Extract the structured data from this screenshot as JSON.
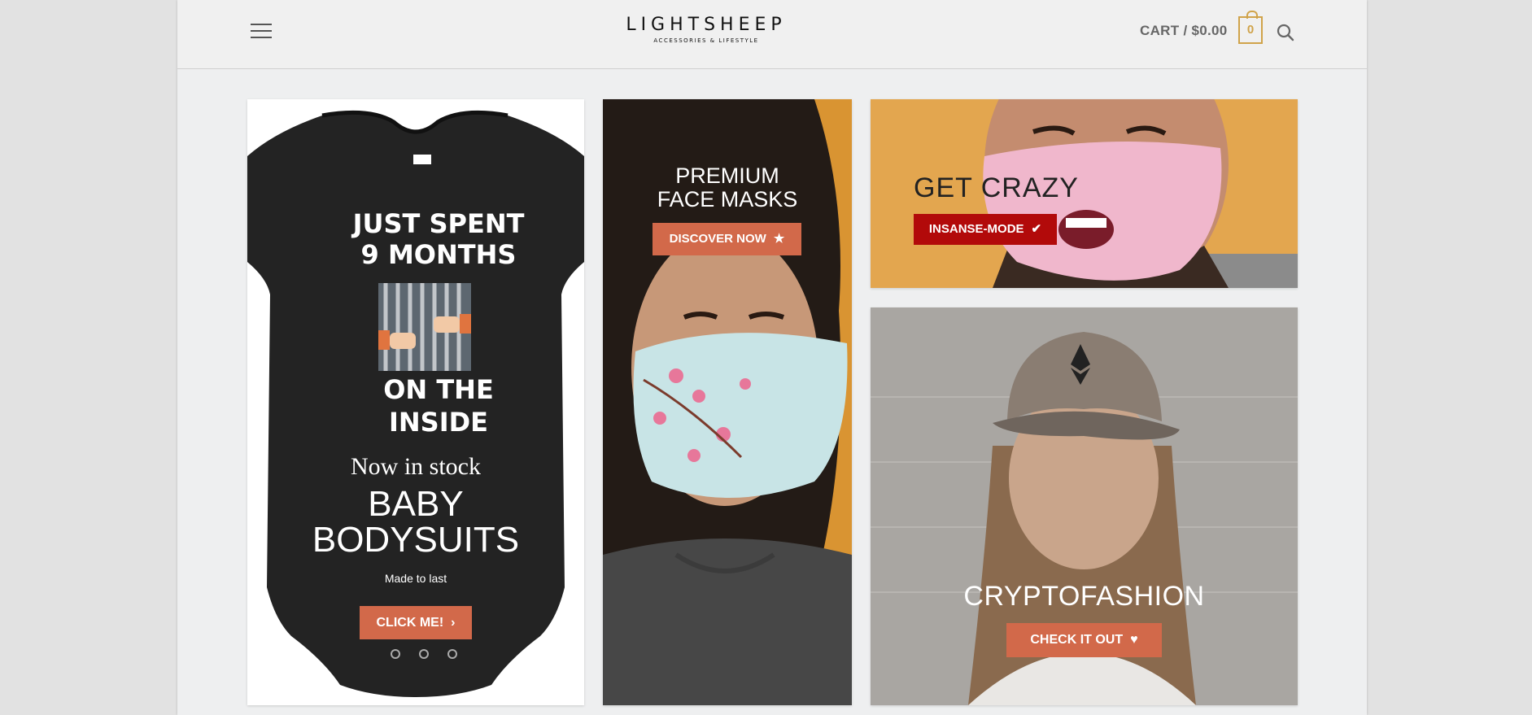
{
  "header": {
    "logo_main": "LIGHTSHEEP",
    "logo_sub": "ACCESSORIES & LIFESTYLE",
    "cart_label": "CART / $0.00",
    "cart_count": "0"
  },
  "banners": [
    {
      "print_line1": "JUST SPENT",
      "print_line2": "9 MONTHS",
      "print_line3": "ON THE",
      "print_line4": "INSIDE",
      "tagline": "Now in stock",
      "title_line1": "BABY",
      "title_line2": "BODYSUITS",
      "subtitle": "Made to last",
      "button_label": "CLICK ME!",
      "button_icon": "chevron-right-icon"
    },
    {
      "title_line1": "PREMIUM",
      "title_line2": "FACE MASKS",
      "button_label": "DISCOVER NOW",
      "button_icon": "star-icon"
    },
    {
      "title": "GET CRAZY",
      "button_label": "INSANSE-MODE",
      "button_icon": "checkmark-icon"
    },
    {
      "title": "CRYPTOFASHION",
      "button_label": "CHECK IT OUT",
      "button_icon": "heart-icon"
    }
  ],
  "colors": {
    "accent_button": "#d2694a",
    "crazy_button": "#b20a0a",
    "cart_accent": "#d0a34a"
  }
}
